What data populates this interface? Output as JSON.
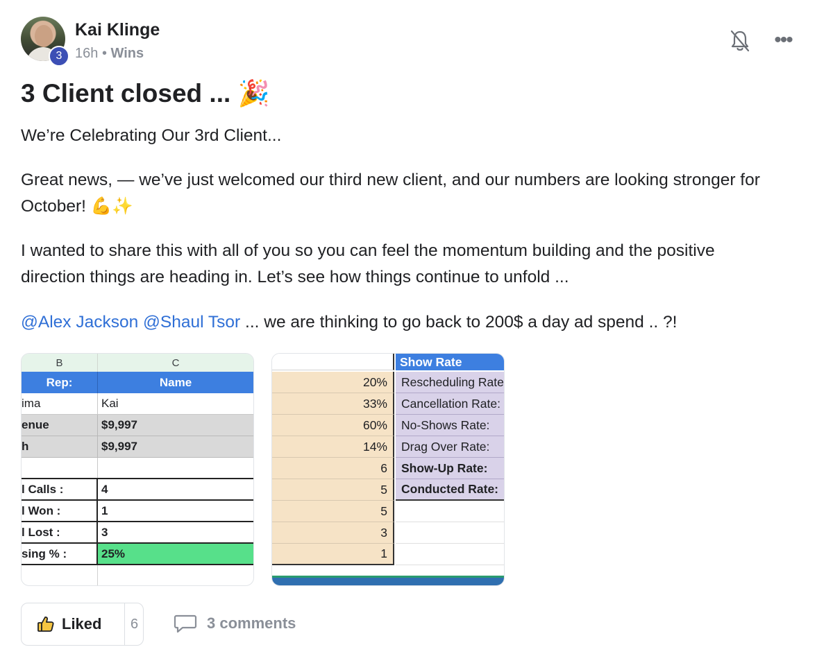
{
  "post": {
    "author": "Kai Klinge",
    "level": "3",
    "time": "16h",
    "separator": "•",
    "category": "Wins",
    "title": "3 Client closed ...",
    "title_emoji": "🎉",
    "paragraphs": {
      "p1": "We’re Celebrating Our 3rd Client...",
      "p2_line1": "Great news, — we’ve just welcomed our third new client, and our numbers are looking stronger for",
      "p2_line2": "October!",
      "p2_emoji": "💪✨",
      "p3_line1": "I wanted to share this with all of you so you can feel the momentum building and the positive",
      "p3_line2": "direction things are heading in. Let’s see how things continue to unfold ..."
    },
    "mentions": {
      "m1": "@Alex Jackson",
      "m2": "@Shaul Tsor"
    },
    "mention_tail": " ... we are thinking to go back to 200$ a day ad spend .. ?!"
  },
  "sheet1": {
    "col_b": "B",
    "col_c": "C",
    "header_left": "Rep:",
    "header_right": "Name",
    "rows": [
      {
        "label": "ima",
        "value": "Kai"
      },
      {
        "label": "enue",
        "value": "$9,997"
      },
      {
        "label": "h",
        "value": "$9,997"
      },
      {
        "label": "",
        "value": ""
      },
      {
        "label": "l Calls :",
        "value": "4"
      },
      {
        "label": "l Won :",
        "value": "1"
      },
      {
        "label": "l Lost :",
        "value": "3"
      },
      {
        "label": "sing % :",
        "value": "25%"
      }
    ]
  },
  "sheet2": {
    "header_right": "Show Rate",
    "rows": [
      {
        "value": "20%",
        "label": "Rescheduling Rate"
      },
      {
        "value": "33%",
        "label": "Cancellation Rate:"
      },
      {
        "value": "60%",
        "label": "No-Shows Rate:"
      },
      {
        "value": "14%",
        "label": "Drag Over Rate:"
      },
      {
        "value": "6",
        "label": "Show-Up Rate:"
      },
      {
        "value": "5",
        "label": "Conducted Rate:"
      },
      {
        "value": "5",
        "label": ""
      },
      {
        "value": "3",
        "label": ""
      },
      {
        "value": "1",
        "label": ""
      }
    ]
  },
  "footer": {
    "like_label": "Liked",
    "like_count": "6",
    "comments_label": "3 comments"
  },
  "icons": {
    "bell": "bell-off-icon",
    "more": "more-dots-icon",
    "thumbs_up": "thumbs-up-icon",
    "comment": "comment-bubble-icon"
  },
  "colors": {
    "mention": "#2f6fd6",
    "level_badge": "#3c4fb5",
    "sheet_header_blue": "#3d7fe0",
    "sheet_green": "#57e08a",
    "sheet_tan": "#f6e3c6",
    "sheet_lavender": "#d9d2e9"
  }
}
